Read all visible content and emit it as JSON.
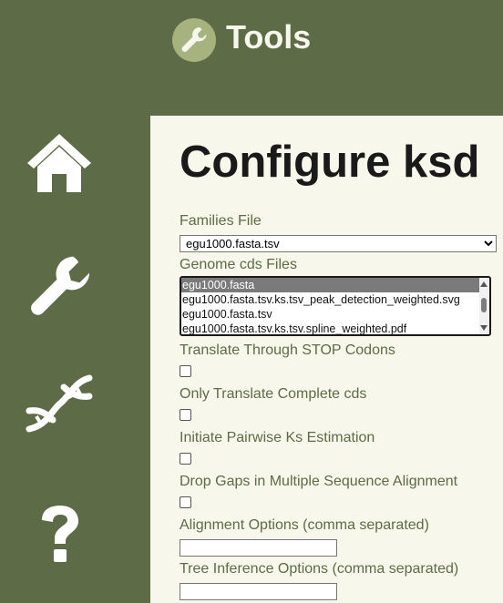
{
  "header": {
    "app_title": "Tools",
    "logo_icon": "wrench-icon"
  },
  "sidebar": {
    "items": [
      {
        "icon": "home-icon"
      },
      {
        "icon": "wrench-icon"
      },
      {
        "icon": "dna-icon"
      },
      {
        "icon": "help-icon"
      }
    ]
  },
  "main": {
    "title": "Configure ksd",
    "families_file": {
      "label": "Families File",
      "selected": "egu1000.fasta.tsv"
    },
    "genome_cds_files": {
      "label": "Genome cds Files",
      "options": [
        {
          "text": "egu1000.fasta",
          "selected": true
        },
        {
          "text": "egu1000.fasta.tsv.ks.tsv_peak_detection_weighted.svg",
          "selected": false
        },
        {
          "text": "egu1000.fasta.tsv",
          "selected": false
        },
        {
          "text": "egu1000.fasta.tsv.ks.tsv.spline_weighted.pdf",
          "selected": false
        }
      ]
    },
    "translate_stop": {
      "label": "Translate Through STOP Codons",
      "checked": false
    },
    "complete_cds": {
      "label": "Only Translate Complete cds",
      "checked": false
    },
    "pairwise_ks": {
      "label": "Initiate Pairwise Ks Estimation",
      "checked": false
    },
    "drop_gaps": {
      "label": "Drop Gaps in Multiple Sequence Alignment",
      "checked": false
    },
    "alignment_options": {
      "label": "Alignment Options (comma separated)",
      "value": ""
    },
    "tree_options": {
      "label": "Tree Inference Options (comma separated)",
      "value": ""
    }
  },
  "colors": {
    "sidebar_bg": "#5d6b46",
    "content_bg": "#f7f7eb",
    "label_text": "#5d6b46",
    "logo_circle": "#a6b37e"
  }
}
